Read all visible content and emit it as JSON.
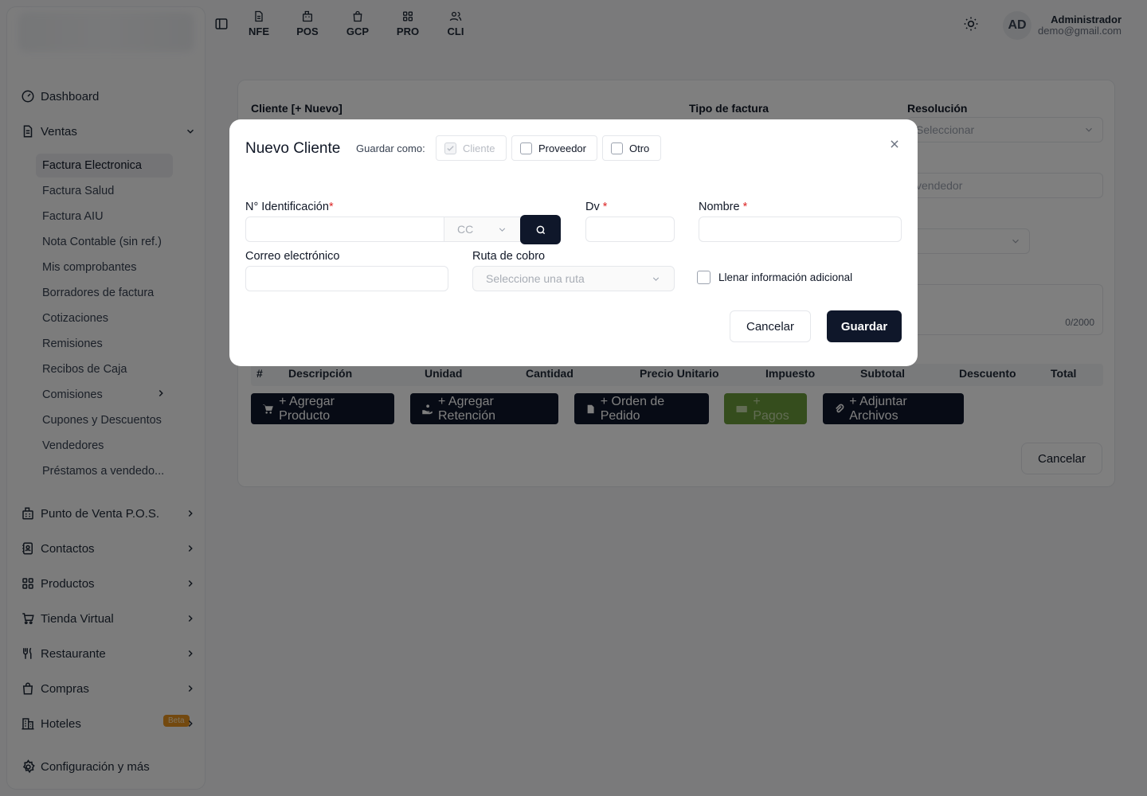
{
  "sidebar": {
    "items": [
      {
        "label": "Dashboard",
        "icon": "gauge-icon"
      },
      {
        "label": "Ventas",
        "icon": "file-text-icon",
        "expanded": true
      },
      {
        "label": "Punto de Venta P.O.S.",
        "icon": "register-icon"
      },
      {
        "label": "Contactos",
        "icon": "contact-book-icon"
      },
      {
        "label": "Productos",
        "icon": "grid-icon"
      },
      {
        "label": "Tienda Virtual",
        "icon": "cart-icon"
      },
      {
        "label": "Restaurante",
        "icon": "utensils-icon"
      },
      {
        "label": "Compras",
        "icon": "shopping-bag-icon"
      },
      {
        "label": "Hoteles",
        "icon": "building-icon",
        "badge": "Beta"
      },
      {
        "label": "Configuración y más",
        "icon": "gear-icon"
      }
    ],
    "ventas_sub": [
      "Factura Electronica",
      "Factura Salud",
      "Factura AIU",
      "Nota Contable (sin ref.)",
      "Mis comprobantes",
      "Borradores de factura",
      "Cotizaciones",
      "Remisiones",
      "Recibos de Caja",
      "Comisiones",
      "Cupones y Descuentos",
      "Vendedores",
      "Préstamos a vendedo..."
    ]
  },
  "topbar": {
    "shortcuts": [
      "NFE",
      "POS",
      "GCP",
      "PRO",
      "CLI"
    ],
    "user": {
      "initials": "AD",
      "name": "Administrador",
      "email": "demo@gmail.com"
    }
  },
  "form": {
    "cliente_label": "Cliente [+ Nuevo]",
    "tipo_label": "Tipo de factura",
    "resolucion_label": "Resolución",
    "resolucion_placeholder": "Seleccionar",
    "vendedor_placeholder": "vendedor",
    "counter": "0/2000",
    "table_headers": [
      "#",
      "Descripción",
      "Unidad",
      "Cantidad",
      "Precio Unitario",
      "Impuesto",
      "Subtotal",
      "Descuento",
      "Total"
    ],
    "buttons": {
      "add_product": "+ Agregar Producto",
      "add_retention": "+ Agregar Retención",
      "order": "+ Orden de Pedido",
      "payments": "+ Pagos",
      "attach": "+ Adjuntar Archivos",
      "cancel": "Cancelar"
    }
  },
  "modal": {
    "title": "Nuevo Cliente",
    "save_as_label": "Guardar como:",
    "types": [
      "Cliente",
      "Proveedor",
      "Otro"
    ],
    "id_label": "N° Identificación",
    "id_type": "CC",
    "dv_label": "Dv",
    "name_label": "Nombre",
    "email_label": "Correo electrónico",
    "route_label": "Ruta de cobro",
    "route_placeholder": "Seleccione una ruta",
    "extra_info_label": "Llenar información adicional",
    "required_mark": "*",
    "cancel": "Cancelar",
    "save": "Guardar"
  }
}
